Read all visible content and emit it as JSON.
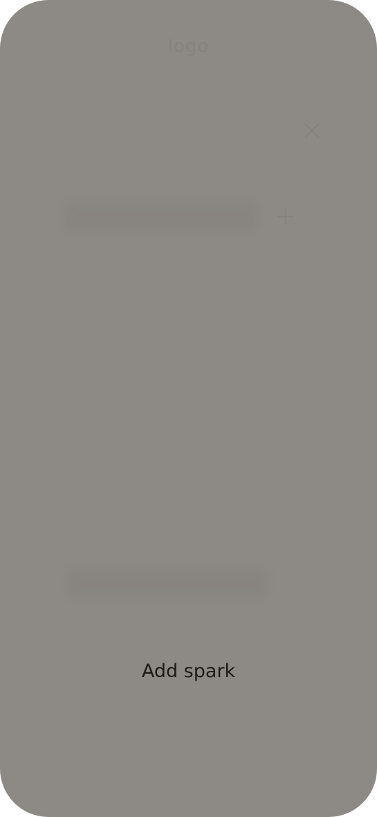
{
  "header": {
    "logo_text": "logo"
  },
  "icons": {
    "close": "close-icon",
    "add": "plus-icon"
  },
  "footer": {
    "add_spark_label": "Add spark"
  },
  "colors": {
    "overlay": "#8d8a85",
    "faded_content": "#86837e",
    "action_text": "#1f1a17"
  }
}
